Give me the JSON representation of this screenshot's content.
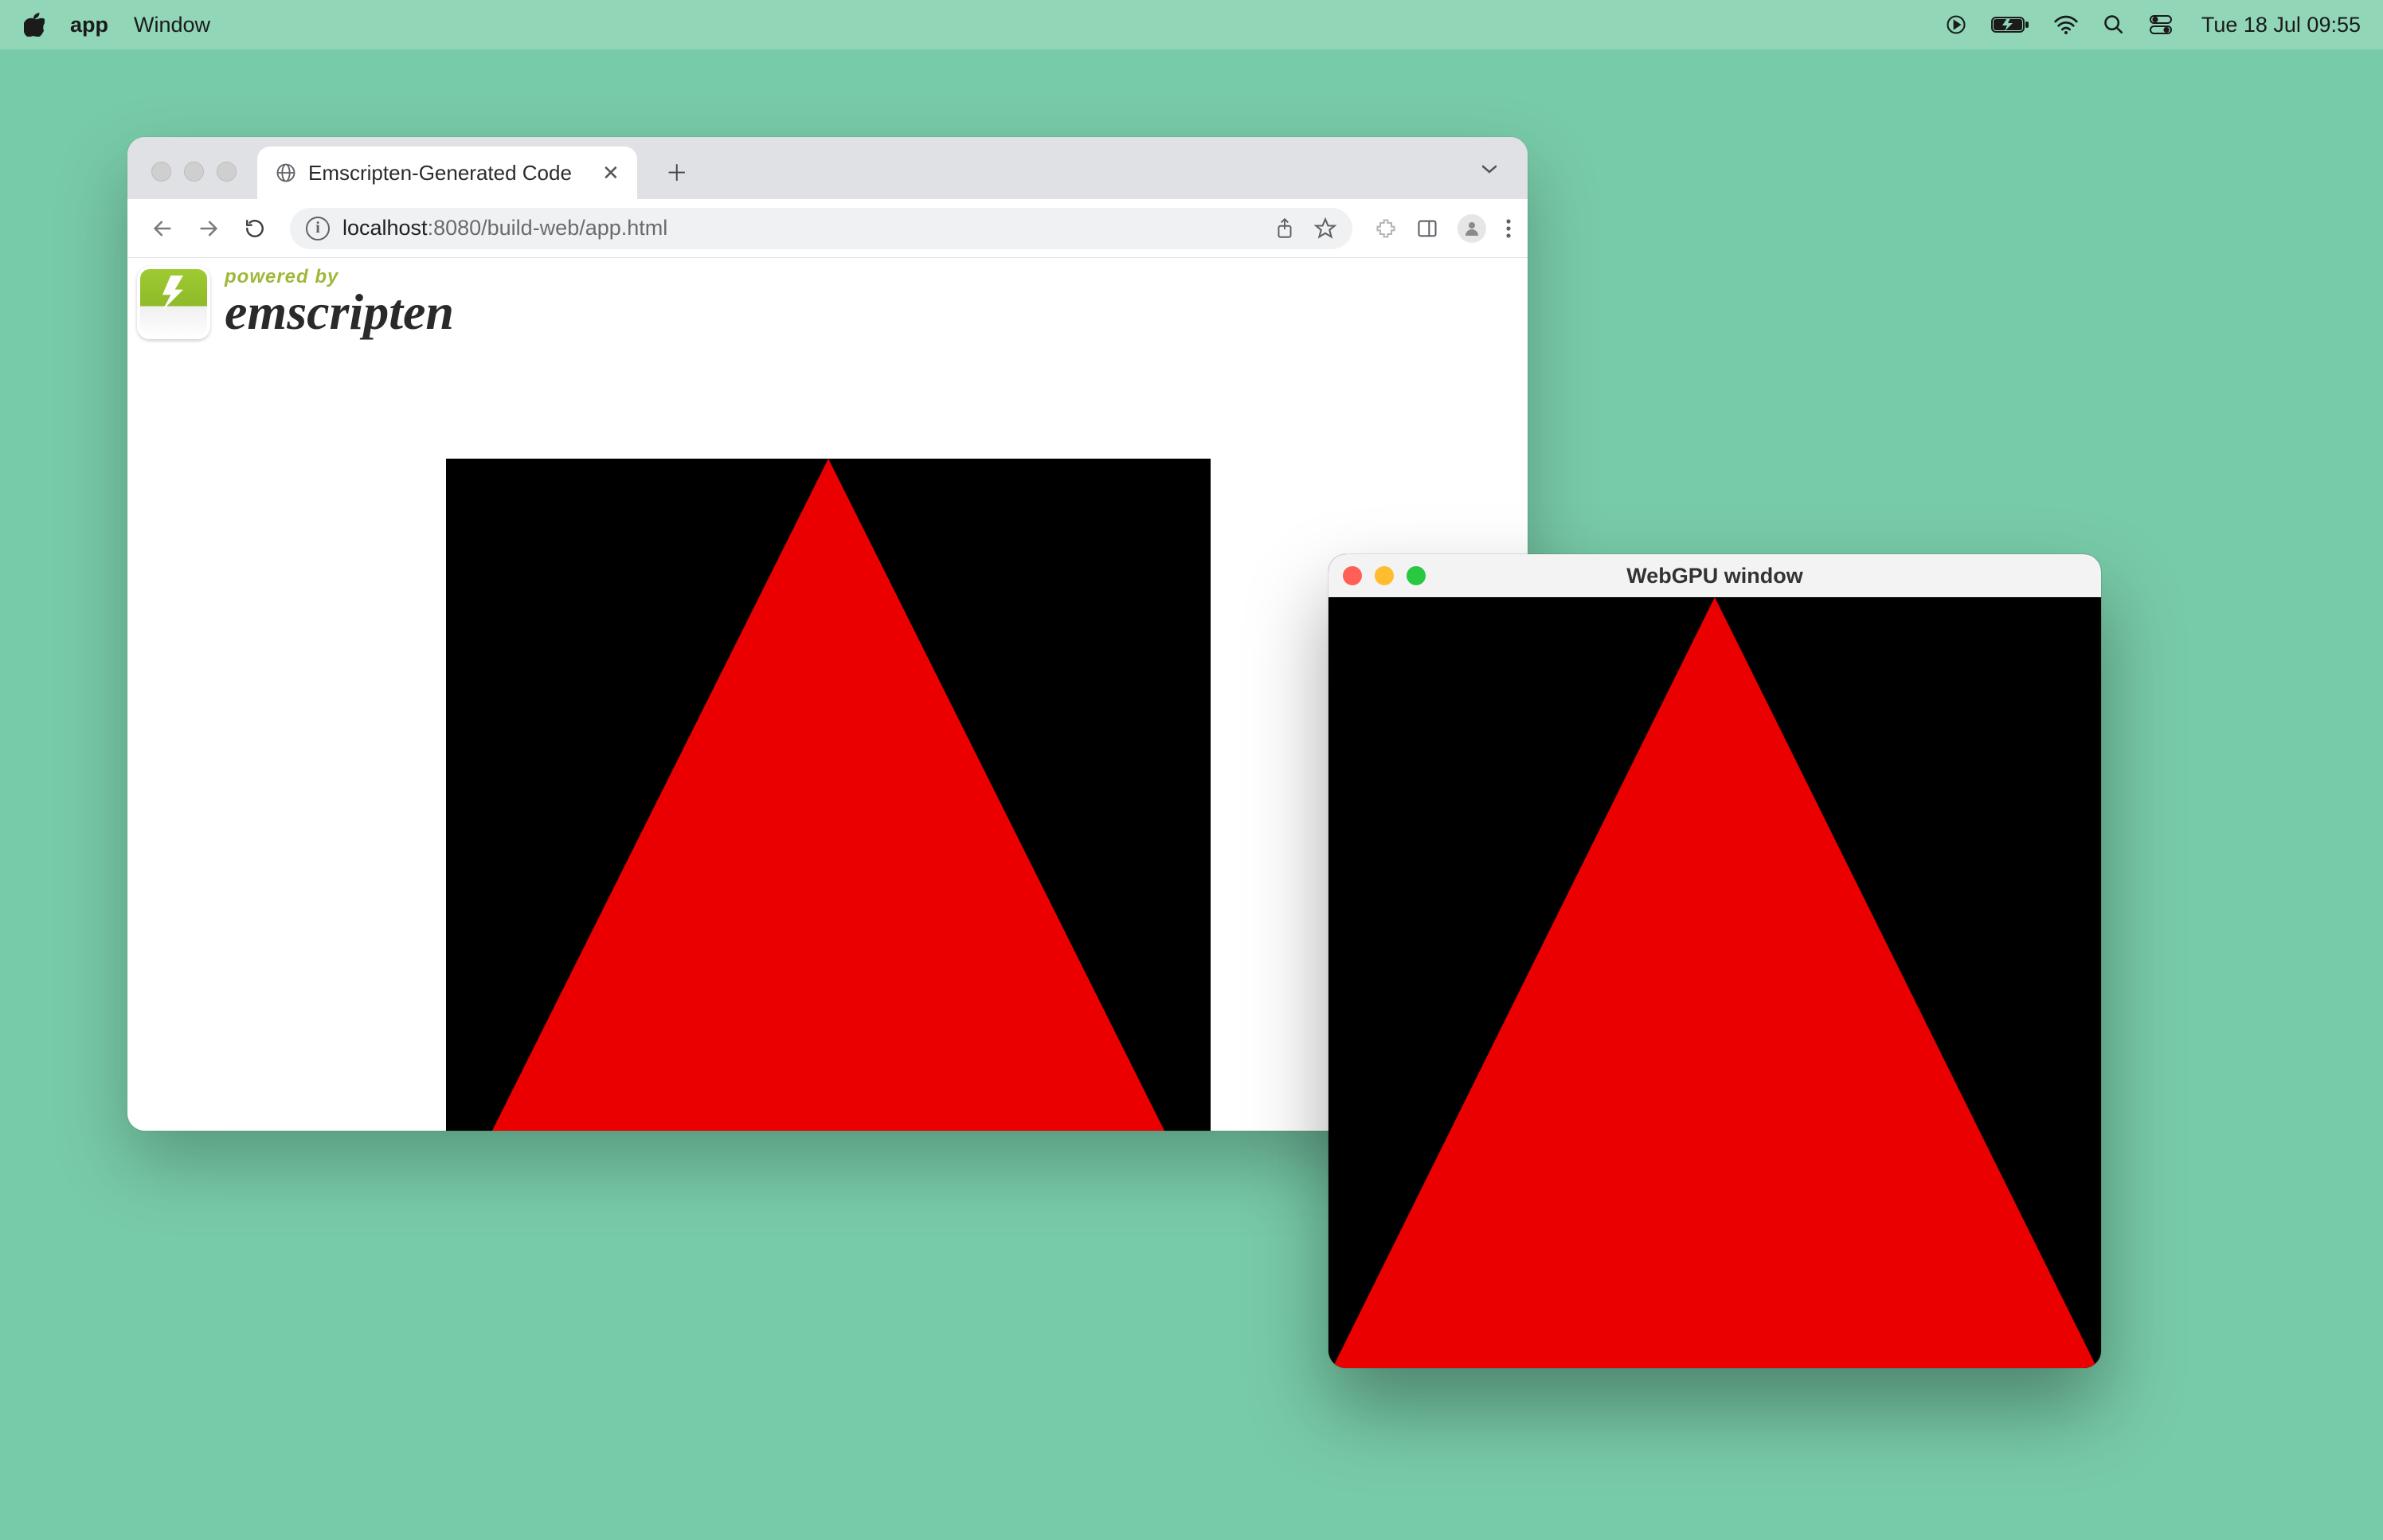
{
  "menubar": {
    "app_name": "app",
    "menu_window": "Window",
    "clock": "Tue 18 Jul  09:55"
  },
  "browser": {
    "tab_title": "Emscripten-Generated Code",
    "url_host": "localhost",
    "url_port_path": ":8080/build-web/app.html",
    "emscripten_powered": "powered by",
    "emscripten_name": "emscripten"
  },
  "native": {
    "title": "WebGPU window"
  },
  "colors": {
    "triangle": "#ea0000",
    "canvas_bg": "#000000",
    "desktop": "#78cba8"
  }
}
